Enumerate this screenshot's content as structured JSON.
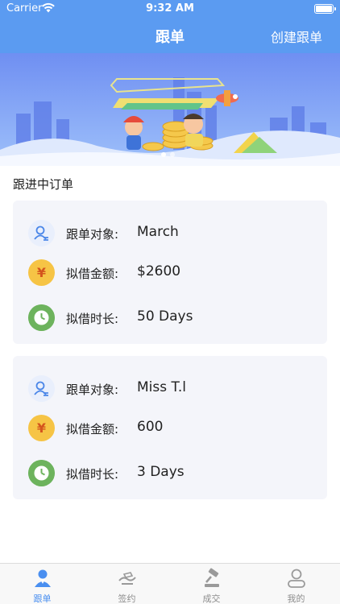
{
  "status_bar": {
    "carrier": "Carrier",
    "time": "9:32 AM"
  },
  "nav": {
    "title": "跟单",
    "right_action": "创建跟单"
  },
  "section": {
    "title": "跟进中订单"
  },
  "orders": [
    {
      "target_label": "跟单对象:",
      "target_value": "March",
      "amount_label": "拟借金额:",
      "amount_value": "$2600",
      "duration_label": "拟借时长:",
      "duration_value": "50 Days"
    },
    {
      "target_label": "跟单对象:",
      "target_value": "Miss T.l",
      "amount_label": "拟借金额:",
      "amount_value": "600",
      "duration_label": "拟借时长:",
      "duration_value": "3 Days"
    }
  ],
  "icons": {
    "yen_glyph": "¥"
  },
  "tabs": [
    {
      "label": "跟单",
      "icon": "user-tab-icon",
      "active": true
    },
    {
      "label": "签约",
      "icon": "sign-tab-icon",
      "active": false
    },
    {
      "label": "成交",
      "icon": "gavel-tab-icon",
      "active": false
    },
    {
      "label": "我的",
      "icon": "profile-tab-icon",
      "active": false
    }
  ],
  "colors": {
    "primary": "#5b9bf1",
    "active_tab": "#4a8ff0",
    "card_bg": "#f4f5fa"
  }
}
